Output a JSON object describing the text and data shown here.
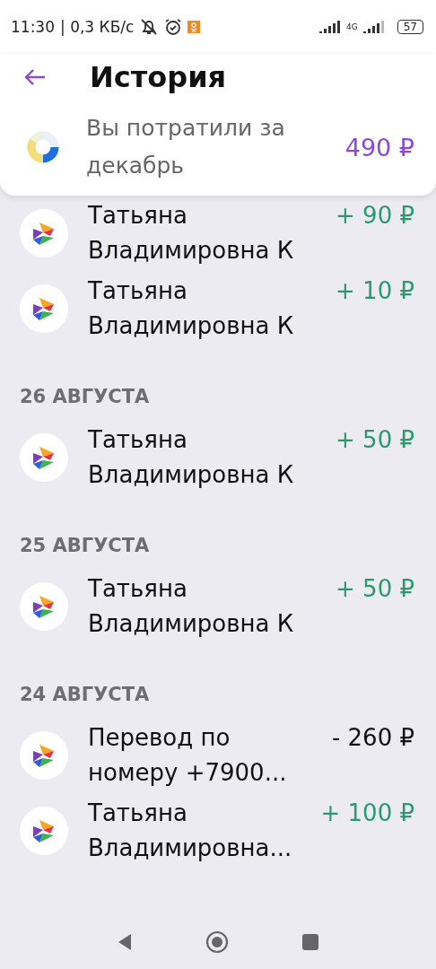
{
  "status_bar": {
    "time": "11:30",
    "speed": "| 0,3 КБ/с",
    "network": "4G",
    "battery": "57"
  },
  "header": {
    "title": "История"
  },
  "summary": {
    "label": "Вы потратили за декабрь",
    "amount": "490 ₽"
  },
  "sections": [
    {
      "items": [
        {
          "name": "Татьяна Владимировна К",
          "amount": "+ 90 ₽",
          "kind": "income"
        },
        {
          "name": "Татьяна Владимировна К",
          "amount": "+ 10 ₽",
          "kind": "income"
        }
      ]
    },
    {
      "date": "26 АВГУСТА",
      "items": [
        {
          "name": "Татьяна Владимировна К",
          "amount": "+ 50 ₽",
          "kind": "income"
        }
      ]
    },
    {
      "date": "25 АВГУСТА",
      "items": [
        {
          "name": "Татьяна Владимировна К",
          "amount": "+ 50 ₽",
          "kind": "income"
        }
      ]
    },
    {
      "date": "24 АВГУСТА",
      "items": [
        {
          "name": "Перевод по номеру +7900...",
          "amount": "- 260 ₽",
          "kind": "expense"
        },
        {
          "name": "Татьяна Владимировна...",
          "amount": "+ 100 ₽",
          "kind": "income"
        }
      ]
    }
  ]
}
